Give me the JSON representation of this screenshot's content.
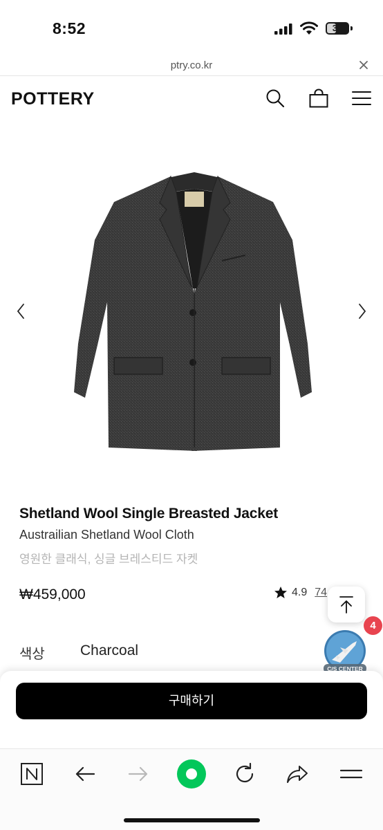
{
  "status_bar": {
    "time": "8:52",
    "battery_level": "39",
    "icons": [
      "signal-icon",
      "wifi-icon",
      "battery-icon"
    ]
  },
  "browser": {
    "url": "ptry.co.kr",
    "close_icon": "close-icon"
  },
  "header": {
    "logo": "POTTERY",
    "icons": [
      "search-icon",
      "shopping-bag-icon",
      "menu-icon"
    ]
  },
  "gallery": {
    "prev_icon": "chevron-left-icon",
    "next_icon": "chevron-right-icon"
  },
  "product": {
    "name": "Shetland Wool Single Breasted Jacket",
    "subtitle": "Austrailian Shetland Wool Cloth",
    "description": "영원한 클래식, 싱글 브레스티드 자켓",
    "price": "₩459,000",
    "rating": "4.9",
    "review_count": "74",
    "option_label": "색상",
    "option_value": "Charcoal"
  },
  "floating": {
    "scroll_top_icon": "arrow-up-icon",
    "cs_center_label": "C/S CENTER",
    "cs_badge": "4"
  },
  "purchase": {
    "buy_label": "구매하기"
  },
  "toolbar": {
    "items": [
      "naver-n-icon",
      "back-arrow-icon",
      "forward-arrow-icon",
      "green-dot-icon",
      "reload-icon",
      "share-icon",
      "menu-icon"
    ]
  },
  "colors": {
    "buy_button": "#000000",
    "badge": "#e8444f",
    "green_dot": "#03c75a",
    "desc_text": "#b4b4b4"
  }
}
